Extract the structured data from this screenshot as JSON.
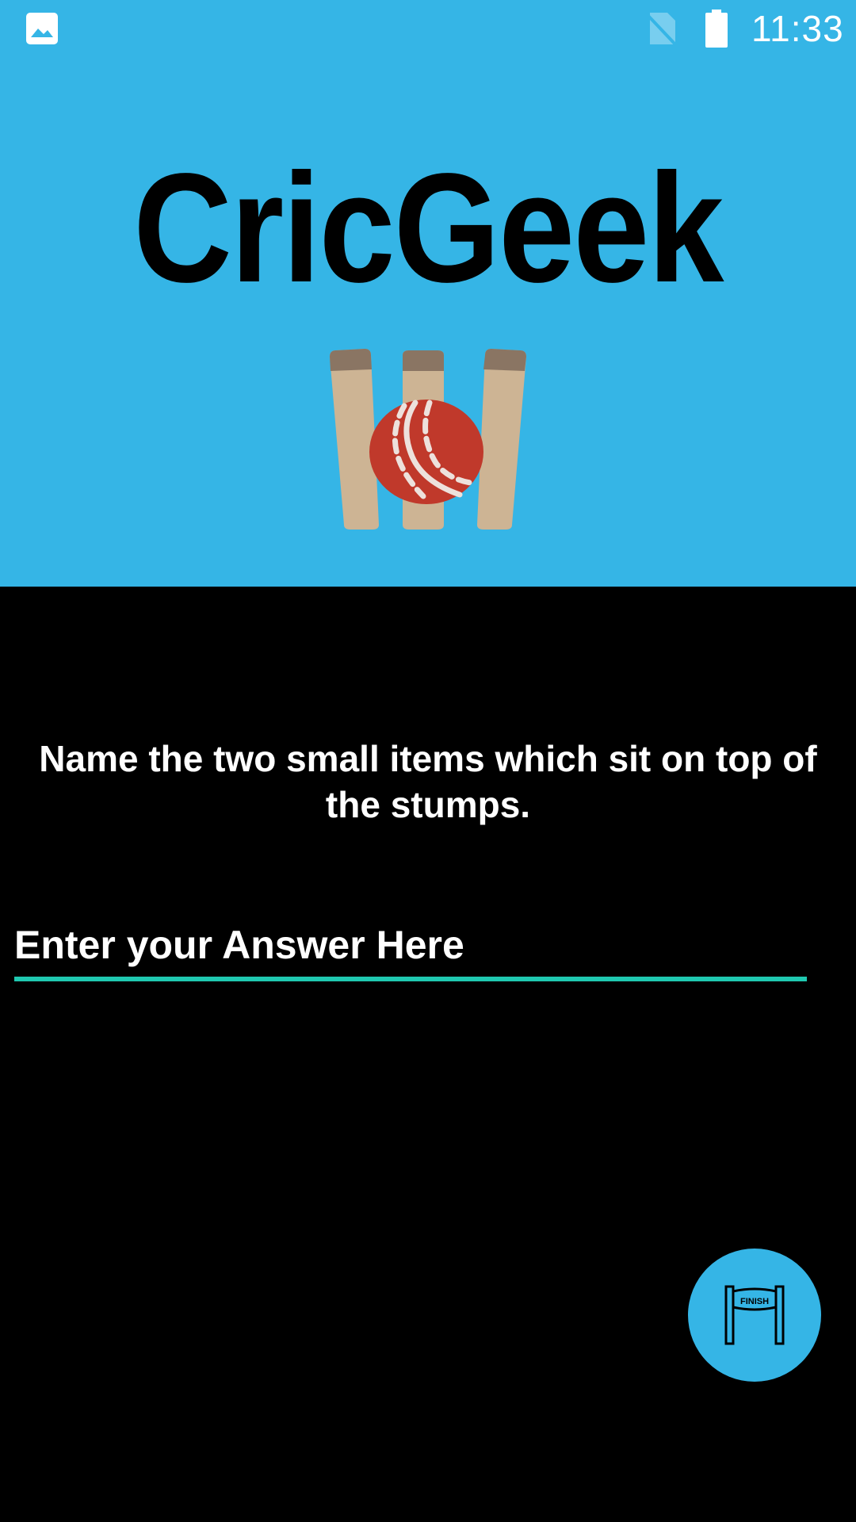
{
  "status_bar": {
    "time": "11:33",
    "icons": [
      "gallery-icon",
      "no-sim-icon",
      "battery-icon"
    ]
  },
  "app": {
    "title": "CricGeek",
    "logo_icon": "cricket-stumps-ball-icon"
  },
  "quiz": {
    "question": "Name the two small items which sit on top of the stumps.",
    "answer_value": "",
    "answer_placeholder": "Enter your Answer Here"
  },
  "fab": {
    "icon": "finish-line-icon",
    "icon_text": "FINISH"
  },
  "colors": {
    "header_bg": "#35B5E6",
    "body_bg": "#000000",
    "input_underline": "#1FC8B0",
    "ball_red": "#C0392B",
    "stump_wood": "#CDB494",
    "stump_top": "#8A7563"
  }
}
